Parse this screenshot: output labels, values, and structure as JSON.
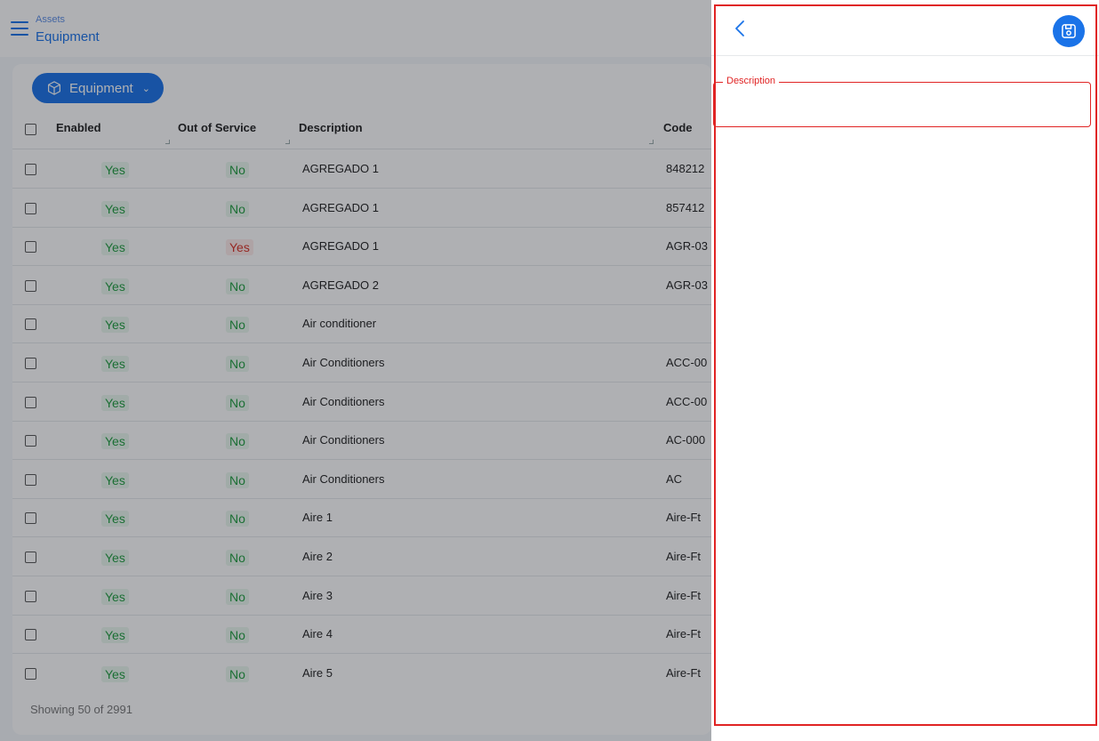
{
  "header": {
    "breadcrumb_parent": "Assets",
    "title": "Equipment"
  },
  "filter": {
    "label": "Equipment"
  },
  "table": {
    "columns": {
      "enabled": "Enabled",
      "out_of_service": "Out of Service",
      "description": "Description",
      "code": "Code"
    },
    "rows": [
      {
        "enabled": "Yes",
        "out_of_service": "No",
        "description": "AGREGADO 1",
        "code": "848212"
      },
      {
        "enabled": "Yes",
        "out_of_service": "No",
        "description": "AGREGADO 1",
        "code": "857412"
      },
      {
        "enabled": "Yes",
        "out_of_service": "Yes",
        "description": "AGREGADO 1",
        "code": "AGR-03"
      },
      {
        "enabled": "Yes",
        "out_of_service": "No",
        "description": "AGREGADO 2",
        "code": "AGR-03"
      },
      {
        "enabled": "Yes",
        "out_of_service": "No",
        "description": "Air conditioner",
        "code": ""
      },
      {
        "enabled": "Yes",
        "out_of_service": "No",
        "description": "Air Conditioners",
        "code": "ACC-00"
      },
      {
        "enabled": "Yes",
        "out_of_service": "No",
        "description": "Air Conditioners",
        "code": "ACC-00"
      },
      {
        "enabled": "Yes",
        "out_of_service": "No",
        "description": "Air Conditioners",
        "code": "AC-000"
      },
      {
        "enabled": "Yes",
        "out_of_service": "No",
        "description": "Air Conditioners",
        "code": "AC"
      },
      {
        "enabled": "Yes",
        "out_of_service": "No",
        "description": "Aire 1",
        "code": "Aire-Ft"
      },
      {
        "enabled": "Yes",
        "out_of_service": "No",
        "description": "Aire 2",
        "code": "Aire-Ft"
      },
      {
        "enabled": "Yes",
        "out_of_service": "No",
        "description": "Aire 3",
        "code": "Aire-Ft"
      },
      {
        "enabled": "Yes",
        "out_of_service": "No",
        "description": "Aire 4",
        "code": "Aire-Ft"
      },
      {
        "enabled": "Yes",
        "out_of_service": "No",
        "description": "Aire 5",
        "code": "Aire-Ft"
      }
    ],
    "footer": "Showing 50 of 2991"
  },
  "drawer": {
    "description_label": "Description",
    "description_value": ""
  },
  "icons": {
    "menu": "hamburger-menu-icon",
    "filter": "cube-icon",
    "dropdown": "chevron-down-icon",
    "back": "chevron-left-icon",
    "save": "floppy-disk-icon"
  },
  "colors": {
    "primary": "#1a73e8",
    "yes_green": "#1f9d3f",
    "yes_red": "#d93025",
    "highlight": "#e02424"
  }
}
